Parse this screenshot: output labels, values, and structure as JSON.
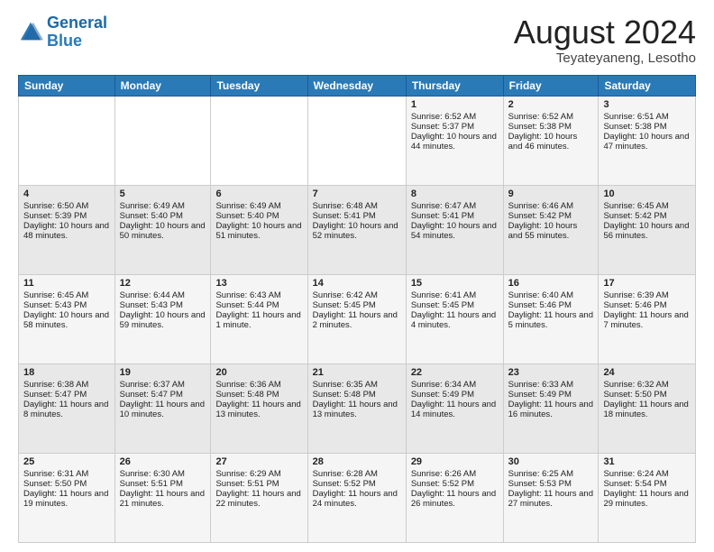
{
  "header": {
    "logo_line1": "General",
    "logo_line2": "Blue",
    "month": "August 2024",
    "location": "Teyateyaneng, Lesotho"
  },
  "days_of_week": [
    "Sunday",
    "Monday",
    "Tuesday",
    "Wednesday",
    "Thursday",
    "Friday",
    "Saturday"
  ],
  "weeks": [
    [
      {
        "day": "",
        "info": ""
      },
      {
        "day": "",
        "info": ""
      },
      {
        "day": "",
        "info": ""
      },
      {
        "day": "",
        "info": ""
      },
      {
        "day": "1",
        "info": "Sunrise: 6:52 AM\nSunset: 5:37 PM\nDaylight: 10 hours and 44 minutes."
      },
      {
        "day": "2",
        "info": "Sunrise: 6:52 AM\nSunset: 5:38 PM\nDaylight: 10 hours and 46 minutes."
      },
      {
        "day": "3",
        "info": "Sunrise: 6:51 AM\nSunset: 5:38 PM\nDaylight: 10 hours and 47 minutes."
      }
    ],
    [
      {
        "day": "4",
        "info": "Sunrise: 6:50 AM\nSunset: 5:39 PM\nDaylight: 10 hours and 48 minutes."
      },
      {
        "day": "5",
        "info": "Sunrise: 6:49 AM\nSunset: 5:40 PM\nDaylight: 10 hours and 50 minutes."
      },
      {
        "day": "6",
        "info": "Sunrise: 6:49 AM\nSunset: 5:40 PM\nDaylight: 10 hours and 51 minutes."
      },
      {
        "day": "7",
        "info": "Sunrise: 6:48 AM\nSunset: 5:41 PM\nDaylight: 10 hours and 52 minutes."
      },
      {
        "day": "8",
        "info": "Sunrise: 6:47 AM\nSunset: 5:41 PM\nDaylight: 10 hours and 54 minutes."
      },
      {
        "day": "9",
        "info": "Sunrise: 6:46 AM\nSunset: 5:42 PM\nDaylight: 10 hours and 55 minutes."
      },
      {
        "day": "10",
        "info": "Sunrise: 6:45 AM\nSunset: 5:42 PM\nDaylight: 10 hours and 56 minutes."
      }
    ],
    [
      {
        "day": "11",
        "info": "Sunrise: 6:45 AM\nSunset: 5:43 PM\nDaylight: 10 hours and 58 minutes."
      },
      {
        "day": "12",
        "info": "Sunrise: 6:44 AM\nSunset: 5:43 PM\nDaylight: 10 hours and 59 minutes."
      },
      {
        "day": "13",
        "info": "Sunrise: 6:43 AM\nSunset: 5:44 PM\nDaylight: 11 hours and 1 minute."
      },
      {
        "day": "14",
        "info": "Sunrise: 6:42 AM\nSunset: 5:45 PM\nDaylight: 11 hours and 2 minutes."
      },
      {
        "day": "15",
        "info": "Sunrise: 6:41 AM\nSunset: 5:45 PM\nDaylight: 11 hours and 4 minutes."
      },
      {
        "day": "16",
        "info": "Sunrise: 6:40 AM\nSunset: 5:46 PM\nDaylight: 11 hours and 5 minutes."
      },
      {
        "day": "17",
        "info": "Sunrise: 6:39 AM\nSunset: 5:46 PM\nDaylight: 11 hours and 7 minutes."
      }
    ],
    [
      {
        "day": "18",
        "info": "Sunrise: 6:38 AM\nSunset: 5:47 PM\nDaylight: 11 hours and 8 minutes."
      },
      {
        "day": "19",
        "info": "Sunrise: 6:37 AM\nSunset: 5:47 PM\nDaylight: 11 hours and 10 minutes."
      },
      {
        "day": "20",
        "info": "Sunrise: 6:36 AM\nSunset: 5:48 PM\nDaylight: 11 hours and 13 minutes."
      },
      {
        "day": "21",
        "info": "Sunrise: 6:35 AM\nSunset: 5:48 PM\nDaylight: 11 hours and 13 minutes."
      },
      {
        "day": "22",
        "info": "Sunrise: 6:34 AM\nSunset: 5:49 PM\nDaylight: 11 hours and 14 minutes."
      },
      {
        "day": "23",
        "info": "Sunrise: 6:33 AM\nSunset: 5:49 PM\nDaylight: 11 hours and 16 minutes."
      },
      {
        "day": "24",
        "info": "Sunrise: 6:32 AM\nSunset: 5:50 PM\nDaylight: 11 hours and 18 minutes."
      }
    ],
    [
      {
        "day": "25",
        "info": "Sunrise: 6:31 AM\nSunset: 5:50 PM\nDaylight: 11 hours and 19 minutes."
      },
      {
        "day": "26",
        "info": "Sunrise: 6:30 AM\nSunset: 5:51 PM\nDaylight: 11 hours and 21 minutes."
      },
      {
        "day": "27",
        "info": "Sunrise: 6:29 AM\nSunset: 5:51 PM\nDaylight: 11 hours and 22 minutes."
      },
      {
        "day": "28",
        "info": "Sunrise: 6:28 AM\nSunset: 5:52 PM\nDaylight: 11 hours and 24 minutes."
      },
      {
        "day": "29",
        "info": "Sunrise: 6:26 AM\nSunset: 5:52 PM\nDaylight: 11 hours and 26 minutes."
      },
      {
        "day": "30",
        "info": "Sunrise: 6:25 AM\nSunset: 5:53 PM\nDaylight: 11 hours and 27 minutes."
      },
      {
        "day": "31",
        "info": "Sunrise: 6:24 AM\nSunset: 5:54 PM\nDaylight: 11 hours and 29 minutes."
      }
    ]
  ]
}
